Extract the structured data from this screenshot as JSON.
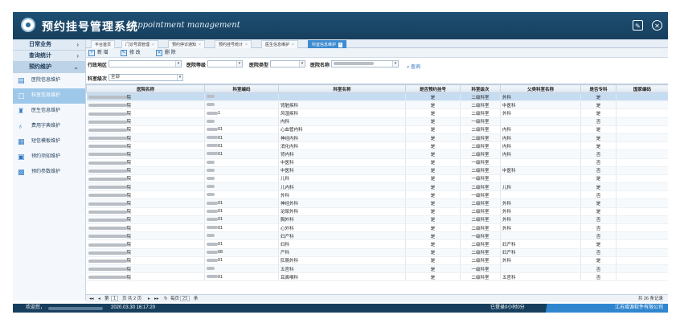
{
  "header": {
    "title": "预约挂号管理系统",
    "subtitle": "Appointment management",
    "edit_icon": "edit-icon",
    "close_icon": "close-circle-icon"
  },
  "sidebar": {
    "sections": [
      {
        "label": "日常业务",
        "chevron": "›"
      },
      {
        "label": "查询统计",
        "chevron": "›"
      },
      {
        "label": "预约维护",
        "chevron": "⌄"
      }
    ],
    "items": [
      {
        "label": "医院信息维护",
        "icon": "bar-chart-icon",
        "glyph": "▤"
      },
      {
        "label": "科室信息维护",
        "icon": "document-icon",
        "glyph": "▢"
      },
      {
        "label": "医生信息维护",
        "icon": "doctor-icon",
        "glyph": "♜"
      },
      {
        "label": "费用字典维护",
        "icon": "money-bag-icon",
        "glyph": "♁"
      },
      {
        "label": "短信模板维护",
        "icon": "message-icon",
        "glyph": "▦"
      },
      {
        "label": "预约须知维护",
        "icon": "notice-icon",
        "glyph": "▣"
      },
      {
        "label": "预约参数维护",
        "icon": "settings-grid-icon",
        "glyph": "▩"
      }
    ]
  },
  "tabs": [
    {
      "label": "平台首页",
      "closable": false
    },
    {
      "label": "门诊号源管理",
      "closable": true
    },
    {
      "label": "预约停诊通知",
      "closable": true
    },
    {
      "label": "预约挂号统计",
      "closable": true
    },
    {
      "label": "医生信息维护",
      "closable": true
    },
    {
      "label": "科室信息维护",
      "closable": true
    }
  ],
  "toolbar": {
    "add": "新 增",
    "edit": "修 改",
    "delete": "删 除"
  },
  "filters": {
    "district_label": "行政地区",
    "level_label": "医院等级",
    "type_label": "医院类型",
    "hospital_label": "医院名称",
    "search_label": "查询",
    "dept_level_label": "科室级次",
    "dept_level_value": "全部"
  },
  "table": {
    "columns": [
      "医院名称",
      "科室编码",
      "科室名称",
      "是否预约挂号",
      "科室级次",
      "父类科室名称",
      "是否专科",
      "国家编码"
    ],
    "rows": [
      [
        "院",
        "",
        "",
        "是",
        "二级科室",
        "外科",
        "是",
        ""
      ],
      [
        "院",
        "",
        "肾脏疾科",
        "是",
        "二级科室",
        "中医科",
        "是",
        ""
      ],
      [
        "院",
        "1",
        "风湿疾科",
        "是",
        "二级科室",
        "外科",
        "是",
        ""
      ],
      [
        "院",
        "",
        "内科",
        "是",
        "一级科室",
        "",
        "否",
        ""
      ],
      [
        "院",
        "01",
        "心血管内科",
        "是",
        "二级科室",
        "内科",
        "是",
        ""
      ],
      [
        "院",
        "01",
        "神经内科",
        "是",
        "二级科室",
        "内科",
        "是",
        ""
      ],
      [
        "院",
        "01",
        "消化内科",
        "是",
        "二级科室",
        "内科",
        "是",
        ""
      ],
      [
        "院",
        "01",
        "肾内科",
        "是",
        "二级科室",
        "内科",
        "否",
        ""
      ],
      [
        "院",
        "",
        "中医科",
        "是",
        "一级科室",
        "",
        "否",
        ""
      ],
      [
        "院",
        "",
        "中医科",
        "是",
        "二级科室",
        "中医科",
        "否",
        ""
      ],
      [
        "院",
        "",
        "儿科",
        "是",
        "一级科室",
        "",
        "是",
        ""
      ],
      [
        "院",
        "",
        "儿内科",
        "是",
        "二级科室",
        "儿科",
        "是",
        ""
      ],
      [
        "院",
        "",
        "外科",
        "是",
        "一级科室",
        "",
        "否",
        ""
      ],
      [
        "院",
        "01",
        "神经外科",
        "是",
        "二级科室",
        "外科",
        "是",
        ""
      ],
      [
        "院",
        "01",
        "泌尿外科",
        "是",
        "二级科室",
        "外科",
        "是",
        ""
      ],
      [
        "院",
        "01",
        "胸外科",
        "是",
        "二级科室",
        "外科",
        "否",
        ""
      ],
      [
        "院",
        "01",
        "心外科",
        "是",
        "二级科室",
        "外科",
        "否",
        ""
      ],
      [
        "院",
        "",
        "妇产科",
        "是",
        "一级科室",
        "",
        "否",
        ""
      ],
      [
        "院",
        "01",
        "妇科",
        "是",
        "二级科室",
        "妇产科",
        "是",
        ""
      ],
      [
        "院",
        "08",
        "产科",
        "是",
        "二级科室",
        "妇产科",
        "否",
        ""
      ],
      [
        "院",
        "01",
        "肛肠外科",
        "是",
        "二级科室",
        "外科",
        "是",
        ""
      ],
      [
        "院",
        "",
        "五官科",
        "是",
        "一级科室",
        "",
        "否",
        ""
      ],
      [
        "院",
        "01",
        "耳鼻喉科",
        "是",
        "二级科室",
        "五官科",
        "否",
        ""
      ]
    ],
    "selected_row": 0
  },
  "pager": {
    "first": "◂◂",
    "prev": "◂",
    "page_prefix": "第",
    "page_value": "1",
    "page_suffix": "页 共 2 页",
    "next": "▸",
    "last": "▸▸",
    "refresh": "↻",
    "per_page_prefix": "每页",
    "per_page_value": "23",
    "per_page_suffix": "条",
    "total": "共 26 条记录"
  },
  "footer": {
    "welcome": "欢迎您，",
    "datetime": "2020.03.30 16:17:20",
    "session": "已登录0小时0分",
    "company": "江苏增源软件有限公司"
  },
  "colors": {
    "header": "#1e4f73",
    "accent": "#3d8bd0",
    "sidebar_active": "#9ec8ea",
    "footer": "#173f5d"
  }
}
